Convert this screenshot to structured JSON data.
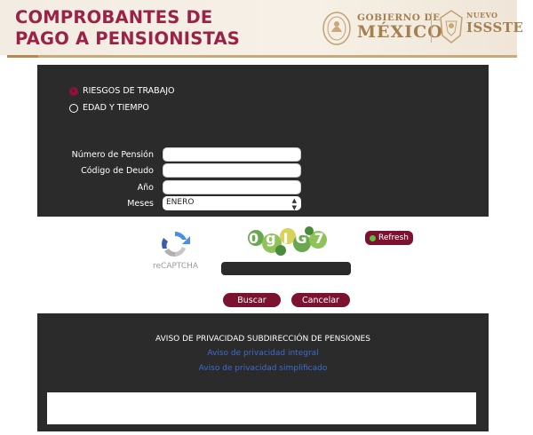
{
  "header": {
    "title_line1": "COMPROBANTES DE",
    "title_line2": "PAGO A PENSIONISTAS",
    "gobierno_line1": "GOBIERNO DE",
    "gobierno_line2": "MÉXICO",
    "issste_nuevo": "NUEVO",
    "issste_name": "ISSSTE"
  },
  "form": {
    "radio_options": [
      {
        "label": "RIESGOS DE TRABAJO",
        "checked": true
      },
      {
        "label": "EDAD Y TIEMPO",
        "checked": false
      }
    ],
    "fields": [
      {
        "label": "Número de Pensión",
        "value": ""
      },
      {
        "label": "Código de Deudo",
        "value": ""
      },
      {
        "label": "Año",
        "value": ""
      }
    ],
    "meses_label": "Meses",
    "meses_value": "ENERO"
  },
  "captcha": {
    "recaptcha_label": "reCAPTCHA",
    "captcha_text": "0gIG7",
    "refresh_label": "Refresh",
    "input_value": ""
  },
  "actions": {
    "search_label": "Buscar",
    "cancel_label": "Cancelar"
  },
  "privacy": {
    "title": "AVISO DE PRIVACIDAD SUBDIRECCIÓN DE PENSIONES",
    "link_integral": "Aviso de privacidad integral",
    "link_simplificado": "Aviso de privacidad simplificado"
  },
  "colors": {
    "brand": "#9b2247",
    "button": "#7a1230",
    "gold": "#a57f4d",
    "panel": "#2b2b2b",
    "link": "#3d6bd1"
  }
}
